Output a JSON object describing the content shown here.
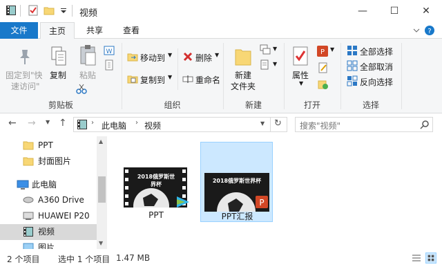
{
  "window": {
    "title": "视频",
    "minimize": "—",
    "maximize": "☐",
    "close": "✕"
  },
  "tabs": [
    "文件",
    "主页",
    "共享",
    "查看"
  ],
  "ribbon": {
    "clipboard": {
      "pin": "固定到\"快",
      "pin2": "速访问\"",
      "copy": "复制",
      "paste": "粘贴",
      "label": "剪贴板"
    },
    "organize": {
      "move_to": "移动到",
      "copy_to": "复制到",
      "delete": "删除",
      "rename": "重命名",
      "label": "组织"
    },
    "new": {
      "new_folder": "新建",
      "new_folder2": "文件夹",
      "label": "新建"
    },
    "open": {
      "properties": "属性",
      "label": "打开"
    },
    "select": {
      "select_all": "全部选择",
      "select_none": "全部取消",
      "invert": "反向选择",
      "label": "选择"
    }
  },
  "address": {
    "path": [
      "此电脑",
      "视频"
    ],
    "search_placeholder": "搜索\"视频\""
  },
  "nav": {
    "items": [
      "PPT",
      "封面图片",
      "此电脑",
      "A360 Drive",
      "HUAWEI P20",
      "视频",
      "图片"
    ]
  },
  "files": [
    {
      "name": "PPT",
      "thumb_text": "2018俄罗斯世界杯"
    },
    {
      "name": "PPT汇报",
      "thumb_text": "2018俄罗斯世界杯"
    }
  ],
  "status": {
    "count": "2 个项目",
    "selected": "选中 1 个项目",
    "size": "1.47 MB"
  },
  "colors": {
    "accent": "#1979ca",
    "selection": "#cce8ff",
    "selection_border": "#99d1ff"
  }
}
